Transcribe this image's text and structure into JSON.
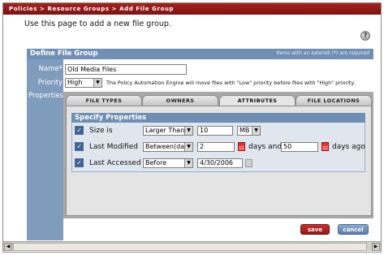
{
  "window": {
    "breadcrumb": "Policies > Resource Groups > Add File Group"
  },
  "intro": "Use this page to add a new file group.",
  "icons": {
    "help": "help-icon",
    "calendar": "calendar-icon"
  },
  "form": {
    "section_title": "Define File Group",
    "required_note": "Items with an asterisk (*) are required",
    "name_label": "Name*",
    "name_value": "Old Media Files",
    "priority_label": "Priority",
    "priority_value": "High",
    "priority_note": "The Policy Automation Engine will move files with \"Low\" priority before files with \"High\" priority.",
    "properties_label": "Properties"
  },
  "tabs": [
    {
      "label": "FILE TYPES",
      "active": false
    },
    {
      "label": "OWNERS",
      "active": false
    },
    {
      "label": "ATTRIBUTES",
      "active": true
    },
    {
      "label": "FILE LOCATIONS",
      "active": false
    }
  ],
  "specify": {
    "title": "Specify Properties",
    "rows": {
      "size": {
        "label": "Size is",
        "checked": true,
        "operator": "Larger Than",
        "value": "10",
        "unit": "MB"
      },
      "modified": {
        "label": "Last Modified",
        "checked": true,
        "operator": "Between(day",
        "from": "2",
        "and_text": "days and",
        "to": "50",
        "suffix": "days ago"
      },
      "accessed": {
        "label": "Last Accessed",
        "checked": true,
        "operator": "Before",
        "date": "4/30/2006"
      }
    }
  },
  "buttons": {
    "save": "save",
    "cancel": "cancel"
  },
  "colors": {
    "title_bar": "#8a1a18",
    "section": "#6f8fb4",
    "save": "#b0241f",
    "cancel": "#6f8fb4"
  }
}
